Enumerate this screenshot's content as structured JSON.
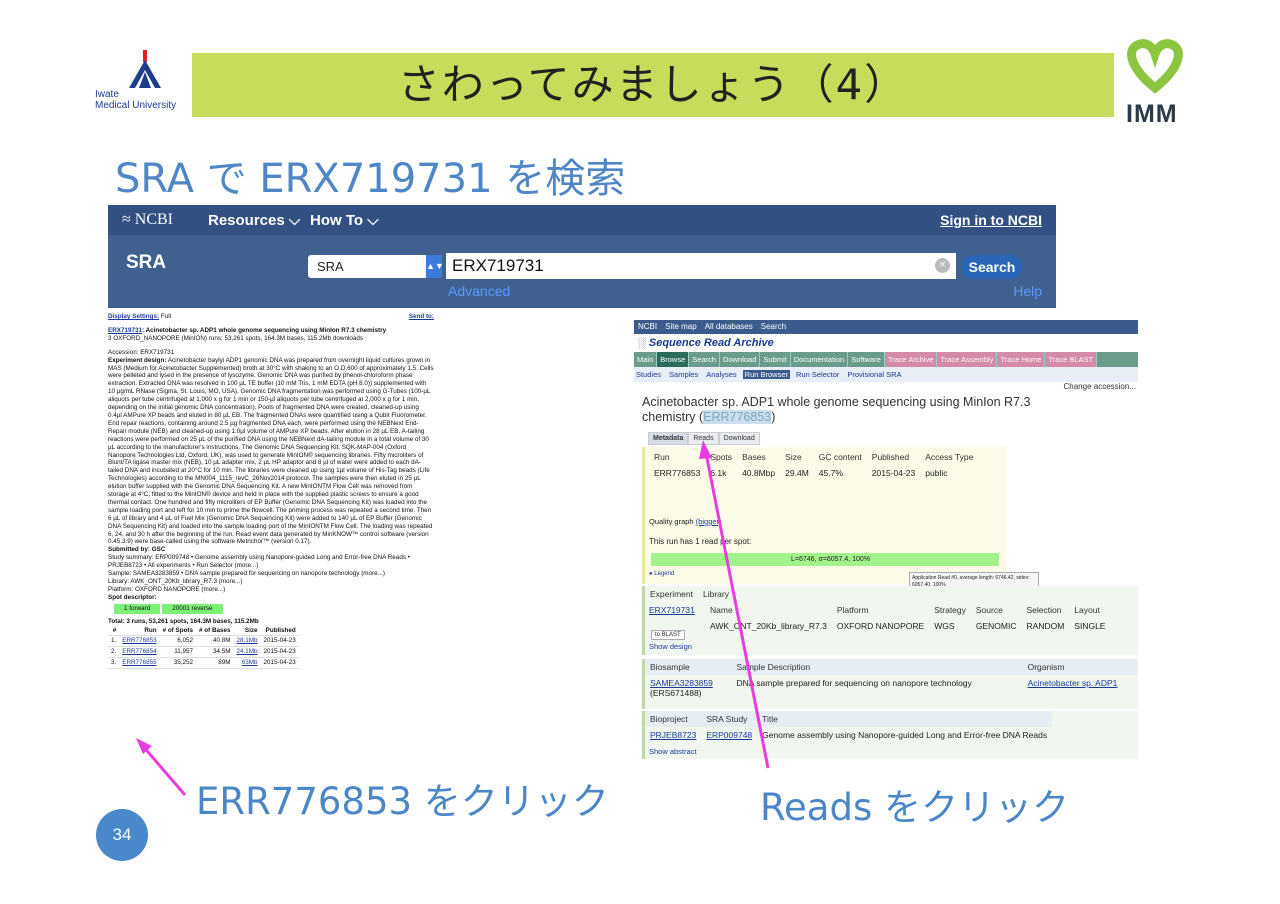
{
  "slide": {
    "title": "さわってみましょう（4）",
    "subtitle": "SRA で ERX719731 を検索",
    "page_number": "34",
    "caption_left": "ERR776853 をクリック",
    "caption_right": "Reads をクリック",
    "logo_left": {
      "line1": "Iwate",
      "line2": "Medical University"
    },
    "logo_right": "IMM",
    "colors": {
      "title_bar": "#c6dc5a",
      "accent_blue": "#4a86c8",
      "arrow": "#e83ce0"
    }
  },
  "ncbi": {
    "logo": "NCBI",
    "resources": "Resources",
    "howto": "How To",
    "signin": "Sign in to NCBI",
    "db_label": "SRA",
    "db_select": "SRA",
    "search_term": "ERX719731",
    "search_button": "Search",
    "advanced": "Advanced",
    "help": "Help"
  },
  "left": {
    "display_settings": "Display Settings:",
    "display_value": "Full",
    "send_to": "Send to:",
    "exp_id": "ERX719731",
    "exp_title": ": Acinetobacter sp. ADP1 whole genome sequencing using MinIon R7.3 chemistry",
    "exp_meta": "3 OXFORD_NANOPORE (MinION) runs: 53,261 spots, 164.3M bases, 115.2Mb downloads",
    "accession": "Accession: ERX719731",
    "design_label": "Experiment design:",
    "design_text": "Acinetobacter baylyi ADP1 genomic DNA was prepared from overnight liquid cultures grown in MAS (Medium for Acinetobacter Supplemented) broth at 30°C with shaking to an O.D.600 of approximately 1.5. Cells were pelleted and lysed in the presence of lysozyme. Genomic DNA was purified by phenol-chloroform phase extraction. Extracted DNA was resolved in 100 µL TE buffer (10 mM Tris, 1 mM EDTA (pH 8.0)) supplemented with 10 µg/mL RNase (Sigma, St. Louis, MO, USA). Genomic DNA fragmentation was performed using G-Tubes (100-µL aliquots per tube centrifuged at 1,000 x g for 1 min or 150-µl aliquots per tube centrifuged at 2,000 x g for 1 min, depending on the initial genomic DNA concentration). Pools of fragmented DNA were created, cleaned-up using 0.4µl AMPure XP beads and eluted in 80 µL EB. The fragmented DNAs were quantified using a Qubit Fluorometer. End repair reactions, containing around 2.5 µg fragmented DNA each, were performed using the NEBNext End-Repair module (NEB) and cleaned-up using 1.0µl volume of AMPure XP beads. After elution in 28 µL EB, A-tailing reactions were performed on 25 µL of the purified DNA using the NEBNext dA-tailing module in a total volume of 30 µL according to the manufacturer's instructions. The Genomic DNA Sequencing Kit, SQK-MAP-004 (Oxford Nanopore Technologies Ltd, Oxford, UK), was used to generate MinION® sequencing libraries. Fifty microliters of Blunt/TA ligase master mix (NEB), 10 µL adapter mix, 2 µL HP adaptor and 8 µl of water were added to each dA-tailed DNA and incubated at 20°C for 10 min. The libraries were cleaned up using 1µl volume of His-Tag beads (Life Technologies) according to the MN004_1115_revC_26Nov2014 protocol. The samples were then eluted in 25 µL elution buffer supplied with the Genomic DNA Sequencing Kit. A new MinIONTM Flow Cell was removed from storage at 4°C, fitted to the MinION® device and held in place with the supplied plastic screws to ensure a good thermal contact. One hundred and fifty microliters of EP Buffer (Genomic DNA Sequencing Kit) was loaded into the sample loading port and left for 10 min to prime the flowcell. The priming process was repeated a second time. Then 6 µL of library and 4 µL of Fuel Mix (Genomic DNA Sequencing Kit) were added to 140 µL of EP Buffer (Genomic DNA Sequencing Kit) and loaded into the sample loading port of the MinIONTM Flow Cell. The loading was repeated 6, 24, and 30 h after the beginning of the run. Read event data generated by MinKNOW™ control software (version 0.45.3.9) were base-called using the software Metrichor™ (version 0.17).",
    "submitted": "Submitted by: GSC",
    "study_line": "Study summary: ERP009748 • Genome assembly using Nanopore-guided Long and Error-free DNA Reads • PRJEB8723 • All experiments • Run Selector (more...)",
    "sample_line": "Sample: SAMEA3283859 • DNA sample prepared for sequencing on nanopore technology (more...)",
    "library_line": "Library: AWK_ONT_20Kb_library_R7.3 (more...)",
    "platform_line": "Platform: OXFORD NANOPORE (more...)",
    "spot_descriptor": "Spot descriptor:",
    "spot_forward": "forward",
    "spot_reverse": "reverse",
    "spot_pos1": "1",
    "spot_pos2": "20001",
    "total_line": "Total: 3 runs, 53,261 spots, 164.3M bases, 115.2Mb",
    "runs_header": [
      "#",
      "Run",
      "# of Spots",
      "# of Bases",
      "Size",
      "Published"
    ],
    "runs": [
      [
        "1.",
        "ERR776853",
        "6,052",
        "40.8M",
        "28.1Mb",
        "2015-04-23"
      ],
      [
        "2.",
        "ERR776854",
        "11,957",
        "34.5M",
        "24.1Mb",
        "2015-04-23"
      ],
      [
        "3.",
        "ERR776855",
        "35,252",
        "89M",
        "63Mb",
        "2015-04-23"
      ]
    ]
  },
  "right": {
    "top_items": [
      "NCBI",
      "Site map",
      "All databases",
      "Search"
    ],
    "sra_title": "Sequence Read Archive",
    "tabs1": [
      "Main",
      "Browse",
      "Search",
      "Download",
      "Submit",
      "Documentation",
      "Software",
      "Trace Archive",
      "Trace Assembly",
      "Trace Home",
      "Trace BLAST"
    ],
    "tabs2": [
      "Studies",
      "Samples",
      "Analyses",
      "Run Browser",
      "Run Selector",
      "Provisional SRA"
    ],
    "change_accession": "Change accession...",
    "run_title": "Acinetobacter sp. ADP1 whole genome sequencing using MinIon R7.3 chemistry",
    "run_id": "ERR776853",
    "meta_tabs": [
      "Metadata",
      "Reads",
      "Download"
    ],
    "run_table_header": [
      "Run",
      "Spots",
      "Bases",
      "Size",
      "GC content",
      "Published",
      "Access Type"
    ],
    "run_table_row": [
      "ERR776853",
      "6.1k",
      "40.8Mbp",
      "29.4M",
      "45.7%",
      "2015-04-23",
      "public"
    ],
    "quality_graph": "Quality graph",
    "bigger": "(bigger)",
    "reads_per_spot": "This run has 1 read per spot:",
    "read_bar": "L=6746, σ=6057.4, 100%",
    "legend": "Legend",
    "tooltip": "Application Read #0, average length: 6746.42, stdev: 6057.40, 100%",
    "exp_header": [
      "Experiment",
      "Library"
    ],
    "exp_id": "ERX719731",
    "to_blast": "to BLAST",
    "lib_header": [
      "Name",
      "Platform",
      "Strategy",
      "Source",
      "Selection",
      "Layout"
    ],
    "lib_row": [
      "AWK_ONT_20Kb_library_R7.3",
      "OXFORD NANOPORE",
      "WGS",
      "GENOMIC",
      "RANDOM",
      "SINGLE"
    ],
    "show_design": "Show design",
    "bio_header": [
      "Biosample",
      "Sample Description",
      "Organism"
    ],
    "bio_row": [
      "SAMEA3283859",
      "DNA sample prepared for sequencing on nanopore technology",
      "Acinetobacter sp. ADP1"
    ],
    "bio_sub": "(ERS671488)",
    "proj_header": [
      "Bioproject",
      "SRA Study",
      "Title"
    ],
    "proj_row": [
      "PRJEB8723",
      "ERP009748",
      "Genome assembly using Nanopore-guided Long and Error-free DNA Reads"
    ],
    "show_abstract": "Show abstract"
  }
}
